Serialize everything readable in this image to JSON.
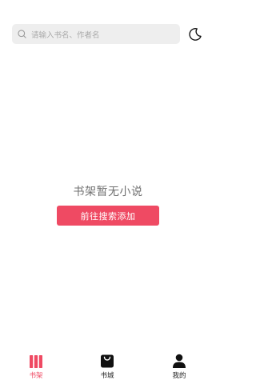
{
  "colors": {
    "accent": "#ef4a63",
    "search_bg": "#eeeeee",
    "placeholder": "#a8a8a8",
    "empty_text": "#707070",
    "tab_inactive": "#222222"
  },
  "header": {
    "search": {
      "icon": "search-icon",
      "placeholder": "请输入书名、作者名"
    },
    "night_mode_icon": "moon-icon"
  },
  "main": {
    "empty_message": "书架暂无小说",
    "cta_label": "前往搜索添加"
  },
  "tabbar": {
    "active": "bookshelf",
    "tabs": [
      {
        "id": "bookshelf",
        "label": "书架",
        "icon": "bookshelf-icon"
      },
      {
        "id": "bookstore",
        "label": "书城",
        "icon": "shopping-bag-icon"
      },
      {
        "id": "mine",
        "label": "我的",
        "icon": "user-icon"
      }
    ]
  }
}
